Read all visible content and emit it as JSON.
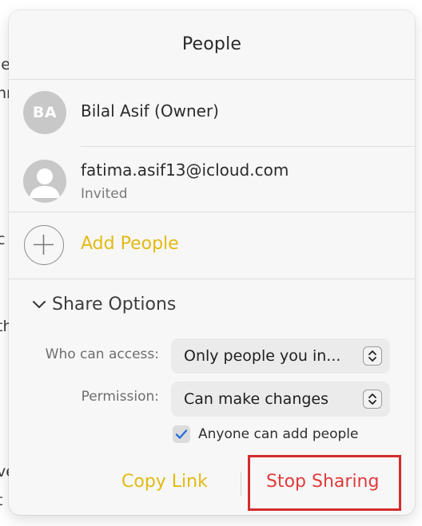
{
  "dialog": {
    "title": "People"
  },
  "participants": [
    {
      "initials": "BA",
      "name": "Bilal Asif (Owner)",
      "status": ""
    },
    {
      "initials": "",
      "name": "fatima.asif13@icloud.com",
      "status": "Invited"
    }
  ],
  "add_people": {
    "label": "Add People"
  },
  "share_options": {
    "heading": "Share Options",
    "access_label": "Who can access:",
    "access_value": "Only people you in...",
    "permission_label": "Permission:",
    "permission_value": "Can make changes",
    "anyone_add_label": "Anyone can add people",
    "anyone_add_checked": true
  },
  "actions": {
    "copy_link": "Copy Link",
    "stop_sharing": "Stop Sharing"
  },
  "background_fragments": [
    "le",
    "nn",
    "I",
    "c",
    "th",
    "I",
    "ve",
    "t"
  ],
  "colors": {
    "accent_yellow": "#e2ba12",
    "destructive_red": "#e03b3b",
    "annotation_red": "#d52b2b",
    "checkbox_blue": "#2a6fdb"
  }
}
